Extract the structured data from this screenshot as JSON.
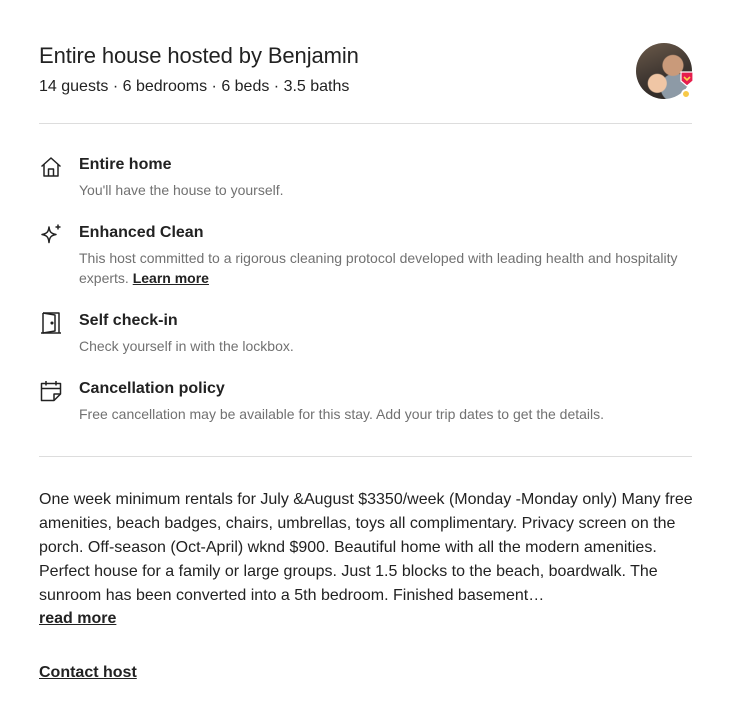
{
  "header": {
    "title": "Entire house hosted by Benjamin",
    "subtitle": "14 guests · 6 bedrooms · 6 beds · 3.5 baths"
  },
  "host": {
    "avatar_icon": "host-avatar",
    "badge_icon": "superhost-badge-icon",
    "badge_color": "#e61e4d"
  },
  "features": [
    {
      "icon": "house-icon",
      "title": "Entire home",
      "description": "You'll have the house to yourself."
    },
    {
      "icon": "sparkle-icon",
      "title": "Enhanced Clean",
      "description": "This host committed to a rigorous cleaning protocol developed with leading health and hospitality experts.",
      "link": "Learn more"
    },
    {
      "icon": "door-icon",
      "title": "Self check-in",
      "description": "Check yourself in with the lockbox."
    },
    {
      "icon": "calendar-icon",
      "title": "Cancellation policy",
      "description": "Free cancellation may be available for this stay. Add your trip dates to get the details."
    }
  ],
  "description": {
    "text": "One week minimum rentals for July &August $3350/week (Monday -Monday only) Many free amenities, beach badges, chairs, umbrellas, toys all complimentary. Privacy screen on the porch. Off-season (Oct-April) wknd $900. Beautiful home with all the modern amenities. Perfect house for a family or large groups. Just 1.5 blocks to the beach, boardwalk. The sunroom has been converted into a 5th bedroom. Finished basement…",
    "read_more": "read more"
  },
  "contact_host": "Contact host",
  "colors": {
    "text_primary": "#222222",
    "text_secondary": "#717171",
    "divider": "#dddddd"
  }
}
